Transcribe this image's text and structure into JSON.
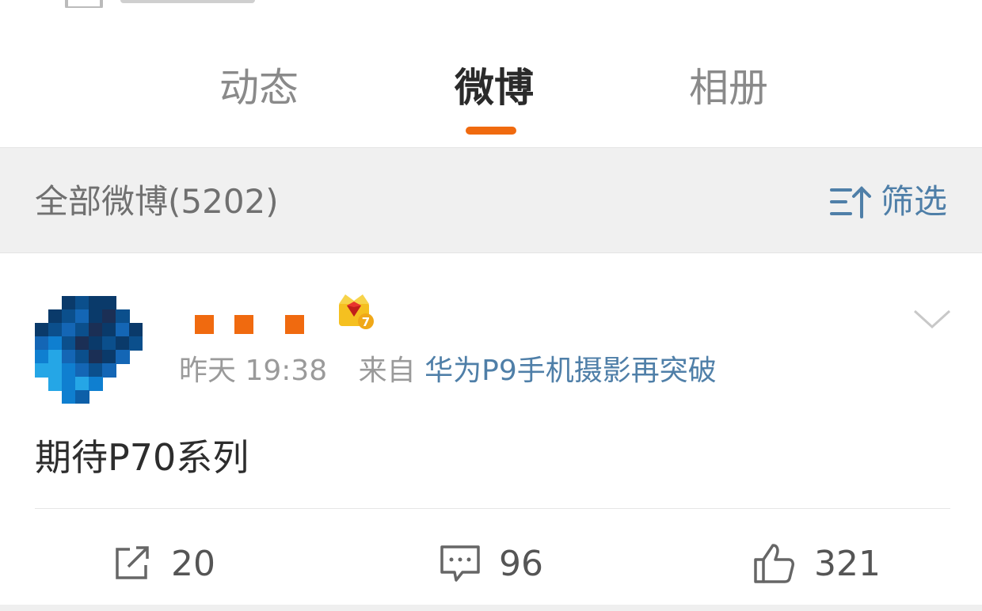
{
  "tabs": [
    {
      "label": "动态",
      "active": false
    },
    {
      "label": "微博",
      "active": true
    },
    {
      "label": "相册",
      "active": false
    }
  ],
  "colors": {
    "accent_orange": "#f06a0f",
    "link_blue": "#4f7fa8",
    "filter_bg": "#f0f0f0"
  },
  "filter_bar": {
    "title": "全部微博(5202)",
    "filter_label": "筛选",
    "filter_icon": "sort-filter-icon"
  },
  "post": {
    "vip_badge_icon": "vip-crown-icon",
    "vip_level": "7",
    "time": "昨天 19:38",
    "source_prefix": "来自",
    "source": "华为P9手机摄影再突破",
    "content": "期待P70系列",
    "repost_count": "20",
    "comment_count": "96",
    "like_count": "321"
  }
}
